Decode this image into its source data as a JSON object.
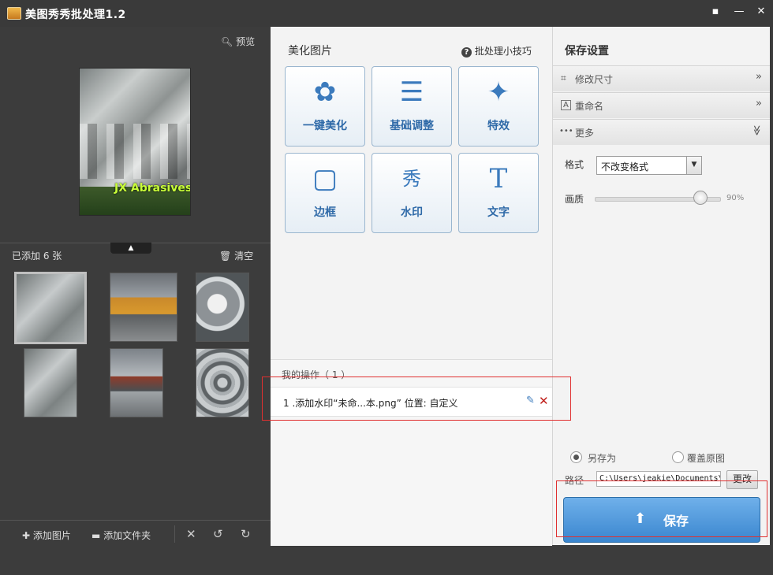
{
  "window": {
    "title": "美图秀秀批处理1.2",
    "controls": [
      "▪",
      "—",
      "✕"
    ]
  },
  "left": {
    "preview_label": "预览",
    "watermark_text": "JX Abrasives",
    "added_count": "已添加 6 张",
    "clear_label": "清空",
    "collapse_icon": "▲",
    "bottom": {
      "add_image": "添加图片",
      "add_folder": "添加文件夹",
      "icons": [
        "✕",
        "↺",
        "↻"
      ]
    }
  },
  "middle": {
    "title": "美化图片",
    "tips_label": "批处理小技巧",
    "tools": [
      {
        "label": "一键美化",
        "icon": "✿"
      },
      {
        "label": "基础调整",
        "icon": "☰"
      },
      {
        "label": "特效",
        "icon": "✦"
      },
      {
        "label": "边框",
        "icon": "▢"
      },
      {
        "label": "水印",
        "icon": "秀"
      },
      {
        "label": "文字",
        "icon": "T"
      }
    ],
    "ops_title": "我的操作（ 1 ）",
    "ops_items": [
      "1 .添加水印“未命...本.png” 位置: 自定义"
    ]
  },
  "right": {
    "title": "保存设置",
    "sections": [
      {
        "label": "修改尺寸",
        "icon": "⌗",
        "chevron": "»"
      },
      {
        "label": "重命名",
        "icon": "A",
        "chevron": "»"
      },
      {
        "label": "更多",
        "icon": "•••",
        "chevron": "≫"
      }
    ],
    "format_label": "格式",
    "format_value": "不改变格式",
    "quality_label": "画质",
    "quality_value": "90%",
    "quality_level": 0.9,
    "save_as_label": "另存为",
    "overwrite_label": "覆盖原图",
    "save_mode": "另存为",
    "path_label": "路径",
    "path_value": "C:\\Users\\jeakie\\Documents\\",
    "change_label": "更改",
    "save_label": "保存"
  },
  "colors": {
    "accent_blue": "#3a86cf",
    "highlight_red": "#e03030",
    "dark_bg": "#3c3c3c"
  }
}
